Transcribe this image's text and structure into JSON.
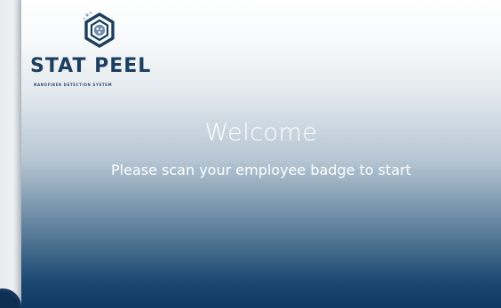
{
  "logo": {
    "name": "STAT PEEL",
    "tagline": "NANOFIBER DETECTION SYSTEM",
    "icon": "hexagon-sample-icon"
  },
  "main": {
    "heading": "Welcome",
    "instruction": "Please scan your employee badge to start"
  },
  "colors": {
    "brand": "#1d3f5f",
    "gradient_top": "#ffffff",
    "gradient_bottom": "#0f3a63",
    "text": "#ffffff"
  }
}
